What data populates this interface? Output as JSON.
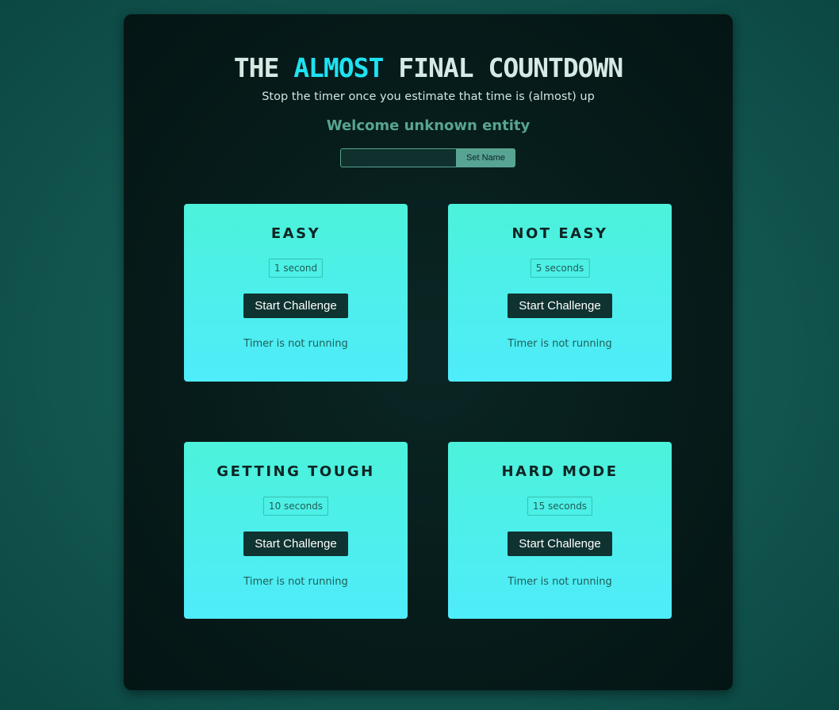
{
  "header": {
    "title_part1": "THE ",
    "title_accent": "ALMOST",
    "title_part2": " FINAL COUNTDOWN",
    "subtitle": "Stop the timer once you estimate that time is (almost) up",
    "welcome": "Welcome unknown entity"
  },
  "name_form": {
    "input_value": "",
    "input_placeholder": "",
    "button_label": "Set Name"
  },
  "challenges": [
    {
      "title": "EASY",
      "duration": "1 second",
      "button_label": "Start Challenge",
      "status": "Timer is not running"
    },
    {
      "title": "NOT EASY",
      "duration": "5 seconds",
      "button_label": "Start Challenge",
      "status": "Timer is not running"
    },
    {
      "title": "GETTING TOUGH",
      "duration": "10 seconds",
      "button_label": "Start Challenge",
      "status": "Timer is not running"
    },
    {
      "title": "HARD MODE",
      "duration": "15 seconds",
      "button_label": "Start Challenge",
      "status": "Timer is not running"
    }
  ],
  "colors": {
    "title": "#d7e9e5",
    "title_accent": "#1ee2f2",
    "welcome": "#58a493",
    "card_top": "#4cf2da",
    "card_bottom": "#4fecfb",
    "button": "#0f3330"
  }
}
